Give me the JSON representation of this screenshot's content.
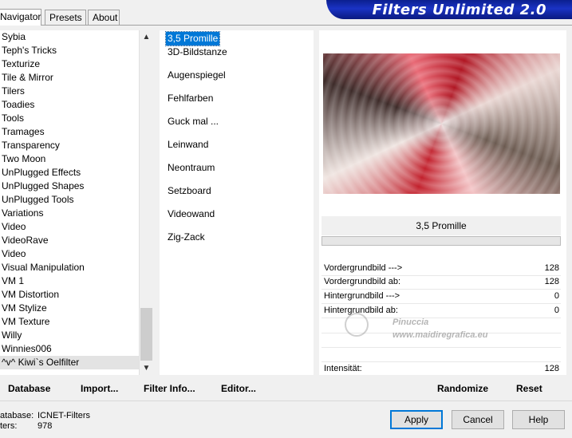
{
  "tabs": [
    "Navigator",
    "Presets",
    "About"
  ],
  "app_title": "Filters Unlimited 2.0",
  "categories": [
    "Sybia",
    "Teph's Tricks",
    "Texturize",
    "Tile & Mirror",
    "Tilers",
    "Toadies",
    "Tools",
    "Tramages",
    "Transparency",
    "Two Moon",
    "UnPlugged Effects",
    "UnPlugged Shapes",
    "UnPlugged Tools",
    "Variations",
    "Video",
    "VideoRave",
    "Video",
    "Visual Manipulation",
    "VM 1",
    "VM Distortion",
    "VM Stylize",
    "VM Texture",
    "Willy",
    "Winnies006",
    "^v^ Kiwi`s Oelfilter"
  ],
  "selected_category": "^v^ Kiwi`s Oelfilter",
  "filters": [
    "3,5 Promille",
    "3D-Bildstanze",
    "Augenspiegel",
    "Fehlfarben",
    "Guck mal ...",
    "Leinwand",
    "Neontraum",
    "Setzboard",
    "Videowand",
    "Zig-Zack"
  ],
  "selected_filter": "3,5 Promille",
  "filter_title": "3,5 Promille",
  "progress": 0,
  "params": [
    {
      "label": "Vordergrundbild --->",
      "value": "128"
    },
    {
      "label": "Vordergrundbild ab:",
      "value": "128"
    },
    {
      "label": "Hintergrundbild --->",
      "value": "0"
    },
    {
      "label": "Hintergrundbild ab:",
      "value": "0"
    },
    {
      "label": "Intensität:",
      "value": "128"
    }
  ],
  "toolbar": {
    "database": "Database",
    "import": "Import...",
    "filter_info": "Filter Info...",
    "editor": "Editor...",
    "randomize": "Randomize",
    "reset": "Reset"
  },
  "status": {
    "database_label": "atabase:",
    "database_value": "ICNET-Filters",
    "filters_label": "ters:",
    "filters_value": "978"
  },
  "buttons": {
    "apply": "Apply",
    "cancel": "Cancel",
    "help": "Help"
  },
  "watermark": {
    "line1": "Pinuccia",
    "line2": "www.maidiregrafica.eu"
  }
}
